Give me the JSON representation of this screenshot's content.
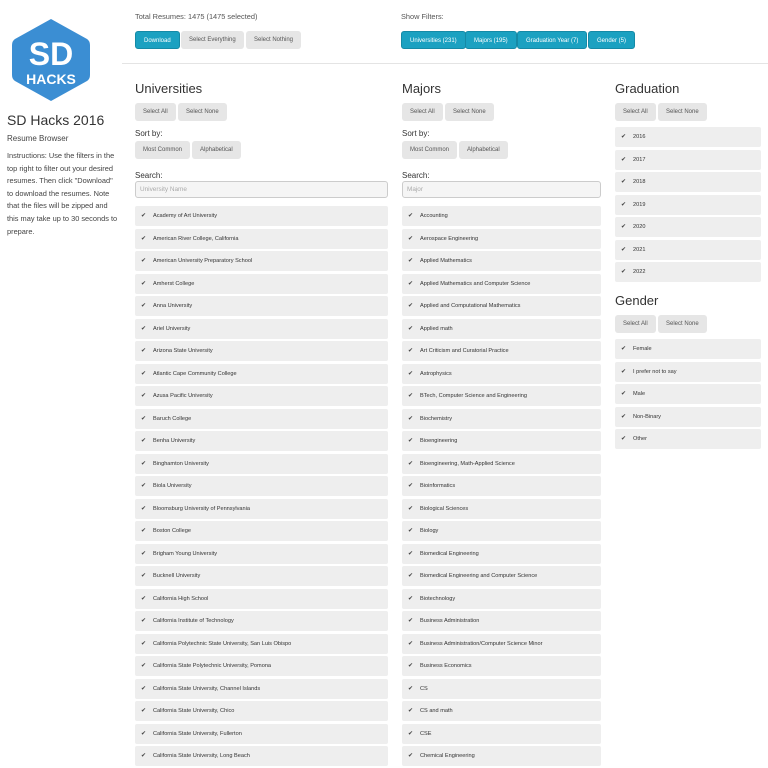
{
  "sidebar": {
    "logo_text_top": "SD",
    "logo_text_bottom": "HACKS",
    "title": "SD Hacks 2016",
    "subtitle": "Resume Browser",
    "instructions": "Instructions: Use the filters in the top right to filter out your desired resumes. Then click \"Download\" to download the resumes. Note that the files will be zipped and this may take up to 30 seconds to prepare."
  },
  "topbar": {
    "total_label": "Total Resumes: 1475 (1475 selected)",
    "download": "Download",
    "select_everything": "Select Everything",
    "select_nothing": "Select Nothing",
    "show_filters_label": "Show Filters:",
    "filters": {
      "universities": "Universities (231)",
      "majors": "Majors (195)",
      "grad_year": "Graduation Year (7)",
      "gender": "Gender (5)"
    }
  },
  "universities": {
    "title": "Universities",
    "select_all": "Select All",
    "select_none": "Select None",
    "sort_by": "Sort by:",
    "most_common": "Most Common",
    "alphabetical": "Alphabetical",
    "search_label": "Search:",
    "search_placeholder": "University Name",
    "items": [
      "Academy of Art University",
      "American River College, California",
      "American University Preparatory School",
      "Amherst College",
      "Anna University",
      "Ariel University",
      "Arizona State University",
      "Atlantic Cape Community College",
      "Azusa Pacific University",
      "Baruch College",
      "Benha University",
      "Binghamton University",
      "Biola University",
      "Bloomsburg University of Pennsylvania",
      "Boston College",
      "Brigham Young University",
      "Bucknell University",
      "California High School",
      "California Institute of Technology",
      "California Polytechnic State University, San Luis Obispo",
      "California State Polytechnic University, Pomona",
      "California State University, Channel Islands",
      "California State University, Chico",
      "California State University, Fullerton",
      "California State University, Long Beach"
    ]
  },
  "majors": {
    "title": "Majors",
    "select_all": "Select All",
    "select_none": "Select None",
    "sort_by": "Sort by:",
    "most_common": "Most Common",
    "alphabetical": "Alphabetical",
    "search_label": "Search:",
    "search_placeholder": "Major",
    "items": [
      "Accounting",
      "Aerospace Engineering",
      "Applied Mathematics",
      "Applied Mathematics and Computer Science",
      "Applied and Computational Mathematics",
      "Applied math",
      "Art Criticism and Curatorial Practice",
      "Astrophysics",
      "BTech, Computer Science and Engineering",
      "Biochemistry",
      "Bioengineering",
      "Bioengineering, Math-Applied Science",
      "Bioinformatics",
      "Biological Sciences",
      "Biology",
      "Biomedical Engineering",
      "Biomedical Engineering and Computer Science",
      "Biotechnology",
      "Business Administration",
      "Business Administration/Computer Science Minor",
      "Business Economics",
      "CS",
      "CS and math",
      "CSE",
      "Chemical Engineering"
    ]
  },
  "graduation": {
    "title": "Graduation",
    "select_all": "Select All",
    "select_none": "Select None",
    "items": [
      "2016",
      "2017",
      "2018",
      "2019",
      "2020",
      "2021",
      "2022"
    ]
  },
  "gender": {
    "title": "Gender",
    "select_all": "Select All",
    "select_none": "Select None",
    "items": [
      "Female",
      "I prefer not to say",
      "Male",
      "Non-Binary",
      "Other"
    ]
  },
  "colors": {
    "primary": "#1ba1c1",
    "logo": "#3b8ed3"
  }
}
